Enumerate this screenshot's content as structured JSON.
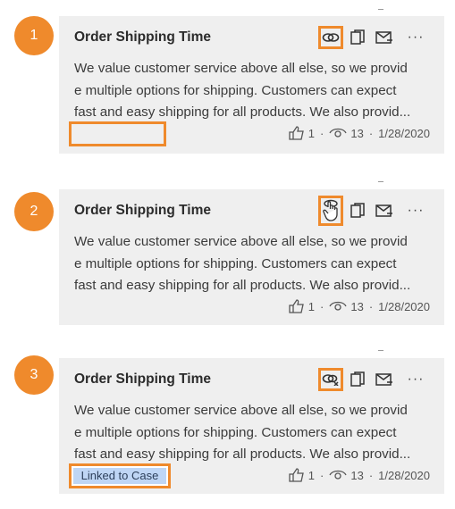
{
  "steps": [
    {
      "number": "1",
      "title": "Order Shipping Time",
      "body": "We value customer service above all else, so we provid\ne multiple options for shipping. Customers can expect\nfast and easy shipping for all products. We also provid...",
      "likes": "1",
      "views": "13",
      "date": "1/28/2020"
    },
    {
      "number": "2",
      "title": "Order Shipping Time",
      "body": "We value customer service above all else, so we provid\ne multiple options for shipping. Customers can expect\nfast and easy shipping for all products. We also provid...",
      "likes": "1",
      "views": "13",
      "date": "1/28/2020"
    },
    {
      "number": "3",
      "title": "Order Shipping Time",
      "body": "We value customer service above all else, so we provid\ne multiple options for shipping. Customers can expect\nfast and easy shipping for all products. We also provid...",
      "likes": "1",
      "views": "13",
      "date": "1/28/2020",
      "badge": "Linked to Case"
    }
  ],
  "icons": {
    "link": "link-icon",
    "hover_link": "hand-cursor-icon",
    "unlink": "link-unlink-icon",
    "copy": "copy-icon",
    "email": "email-icon",
    "more": "more-icon",
    "like": "thumbs-up-icon",
    "views": "eye-icon"
  },
  "colors": {
    "highlight": "#ef8a2c",
    "card_bg": "#efefef",
    "badge_bg": "#bfd6f5"
  }
}
